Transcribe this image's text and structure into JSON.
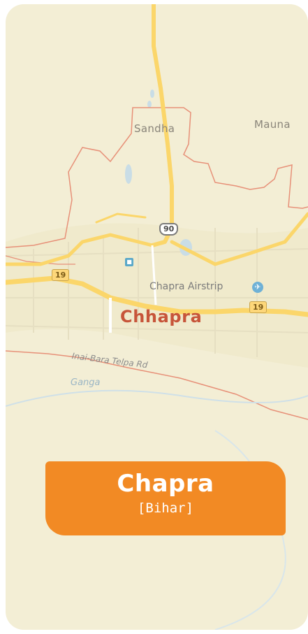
{
  "map": {
    "places": {
      "sandha": "Sandha",
      "mauna": "Mauna",
      "chhapra": "Chhapra",
      "airstrip": "Chapra Airstrip"
    },
    "roads": {
      "nh90": "90",
      "nh19_west": "19",
      "nh19_east": "19",
      "local_road": "Inai-Bara Telpa Rd"
    },
    "river": "Ganga",
    "colors": {
      "land": "#f3eed5",
      "road_major": "#fbd66a",
      "boundary": "#e79078",
      "water": "#c9dde6",
      "city_label": "#c7553a"
    },
    "icons": [
      "airport-icon",
      "bus-stop-icon",
      "highway-shield"
    ]
  },
  "banner": {
    "title": "Chapra",
    "subtitle": "[Bihar]",
    "color": "#f28a24"
  }
}
